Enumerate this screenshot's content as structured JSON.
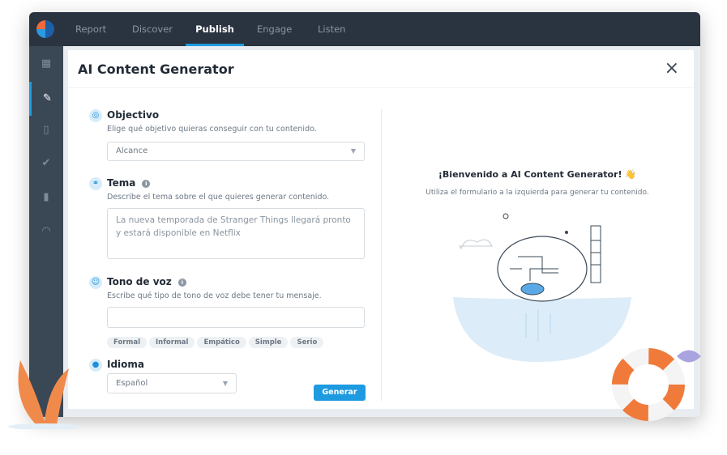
{
  "nav": {
    "tabs": [
      {
        "label": "Report"
      },
      {
        "label": "Discover"
      },
      {
        "label": "Publish",
        "active": true
      },
      {
        "label": "Engage"
      },
      {
        "label": "Listen"
      }
    ]
  },
  "sidebar": {
    "icons": [
      "calendar-icon",
      "compose-icon",
      "document-icon",
      "check-icon",
      "bar-chart-icon",
      "gauge-icon"
    ],
    "active": "compose-icon"
  },
  "modal": {
    "title": "AI Content Generator",
    "close": "×"
  },
  "form": {
    "objetivo": {
      "label": "Objectivo",
      "description": "Elige qué objetivo quieras conseguir con tu contenido.",
      "value": "Alcance"
    },
    "tema": {
      "label": "Tema",
      "description": "Describe el tema sobre el que quieres generar contenido.",
      "value": "La nueva temporada de Stranger Things llegará pronto y estará disponible en Netflix"
    },
    "tono": {
      "label": "Tono de voz",
      "description": "Escribe qué tipo de tono de voz debe tener tu mensaje.",
      "value": "",
      "chips": [
        "Formal",
        "Informal",
        "Empático",
        "Simple",
        "Serio"
      ]
    },
    "idioma": {
      "label": "Idioma",
      "value": "Español"
    },
    "submit": "Generar"
  },
  "welcome": {
    "title": "¡Bienvenido a AI Content Generator!",
    "emoji": "👋",
    "subtitle": "Utiliza el formulario a la izquierda para generar tu contenido."
  },
  "colors": {
    "accent": "#1e9be0",
    "nav": "#2a3340",
    "sidebar": "#3a4856"
  }
}
